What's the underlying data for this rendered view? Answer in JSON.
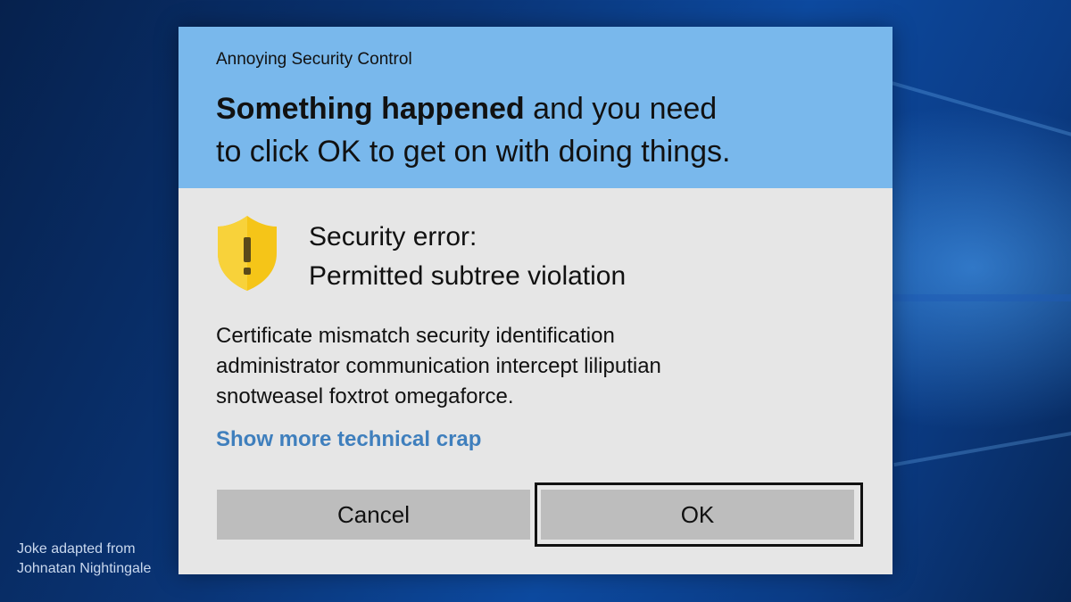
{
  "dialog": {
    "app_name": "Annoying Security Control",
    "headline_bold": "Something happened",
    "headline_rest_1": " and you need",
    "headline_rest_2": "to click OK to get on with doing things.",
    "error_title_1": "Security error:",
    "error_title_2": "Permitted subtree violation",
    "body_1": "Certificate mismatch security identification",
    "body_2": "administrator communication intercept liliputian",
    "body_3": "snotweasel foxtrot omegaforce.",
    "more_link": "Show more technical crap",
    "cancel_label": "Cancel",
    "ok_label": "OK",
    "icon": "shield-warning-icon",
    "colors": {
      "header_bg": "#79b8ec",
      "body_bg": "#e6e6e6",
      "link": "#3f7fbd",
      "shield": "#f5c518",
      "button_bg": "#bdbdbd"
    }
  },
  "credit": {
    "line_1": "Joke adapted from",
    "line_2": "Johnatan Nightingale"
  }
}
